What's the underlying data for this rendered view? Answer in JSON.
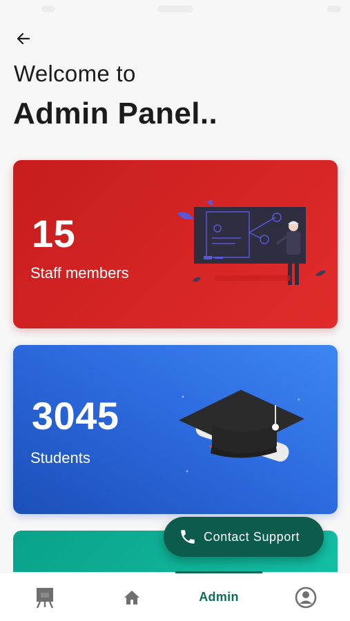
{
  "header": {
    "welcome_text": "Welcome to",
    "title": "Admin Panel.."
  },
  "cards": [
    {
      "count": "15",
      "label": "Staff members",
      "color": "#d42424",
      "illustration": "teacher-blackboard-illustration"
    },
    {
      "count": "3045",
      "label": "Students",
      "color": "#2d6be0",
      "illustration": "graduation-cap-illustration"
    },
    {
      "count": "",
      "label": "",
      "color": "#13c0a4"
    }
  ],
  "fab": {
    "label": "Contact Support",
    "icon": "phone-icon",
    "color": "#0b5c4c"
  },
  "bottom_nav": {
    "items": [
      {
        "icon": "presentation-board-icon",
        "label": ""
      },
      {
        "icon": "home-icon",
        "label": ""
      },
      {
        "icon": "",
        "label": "Admin",
        "active": true
      },
      {
        "icon": "account-circle-icon",
        "label": ""
      }
    ],
    "accent": "#0d6b57"
  }
}
